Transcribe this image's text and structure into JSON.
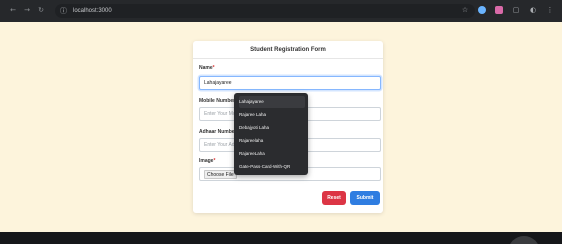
{
  "browser": {
    "url": "localhost:3000",
    "nav_icons": [
      "back-arrow-icon",
      "forward-arrow-icon",
      "reload-icon"
    ],
    "toolbar_icons": [
      "star-icon",
      "extension-icon",
      "account-icon",
      "puzzle-icon",
      "profile-icon",
      "menu-icon"
    ]
  },
  "form": {
    "title": "Student Registration Form",
    "name_label": "Name",
    "name_value": "Lahajayaree",
    "mobile_label": "Mobile Number",
    "mobile_placeholder": "Enter Your Mobile Number",
    "aadhar_label": "Adhaar Number",
    "aadhar_placeholder": "Enter Your Adhaar Number",
    "image_label": "Image",
    "choose_file": "Choose File",
    "no_file": "No file chosen",
    "reset_label": "Reset",
    "submit_label": "Submit",
    "required_mark": "*"
  },
  "autocomplete": {
    "items": [
      "Lahajayaree",
      "Rajaree Laha",
      "Debajyoti Laha",
      "Rajareelaha",
      "RajareeLaha",
      "Gate-Pass-Card-With-QR"
    ],
    "close": "×"
  },
  "colors": {
    "page_bg": "#fdf4dc",
    "reset": "#dc3545",
    "submit": "#2f7de1",
    "dropdown_bg": "#2b2c2f"
  }
}
